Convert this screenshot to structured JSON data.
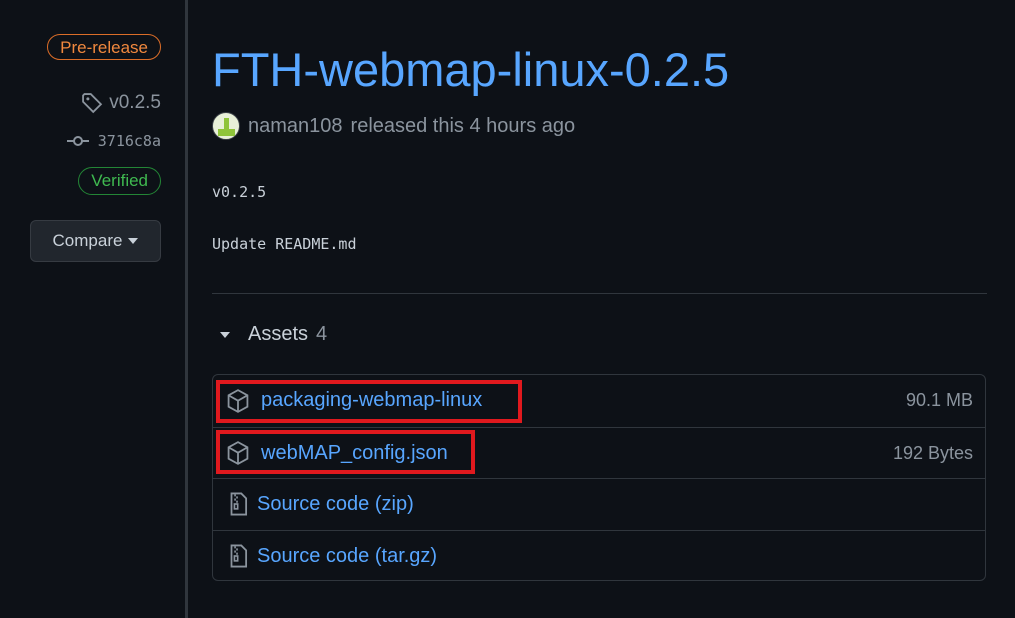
{
  "sidebar": {
    "prerelease_label": "Pre-release",
    "tag": "v0.2.5",
    "commit": "3716c8a",
    "verified_label": "Verified",
    "compare_label": "Compare"
  },
  "release": {
    "title": "FTH-webmap-linux-0.2.5",
    "author": "naman108",
    "released_text": "released this 4 hours ago",
    "body_lines": [
      "v0.2.5",
      "Update README.md"
    ]
  },
  "assets": {
    "header": "Assets",
    "count": "4",
    "items": [
      {
        "name": "packaging-webmap-linux",
        "size": "90.1 MB",
        "icon": "package-icon",
        "highlighted": true
      },
      {
        "name": "webMAP_config.json",
        "size": "192 Bytes",
        "icon": "package-icon",
        "highlighted": true
      },
      {
        "name": "Source code (zip)",
        "size": "",
        "icon": "file-zip-icon",
        "highlighted": false
      },
      {
        "name": "Source code (tar.gz)",
        "size": "",
        "icon": "file-zip-icon",
        "highlighted": false
      }
    ]
  },
  "colors": {
    "background": "#0d1117",
    "link": "#58a6ff",
    "prerelease": "#f0883e",
    "verified": "#3fb950",
    "highlight": "#e0191e"
  }
}
